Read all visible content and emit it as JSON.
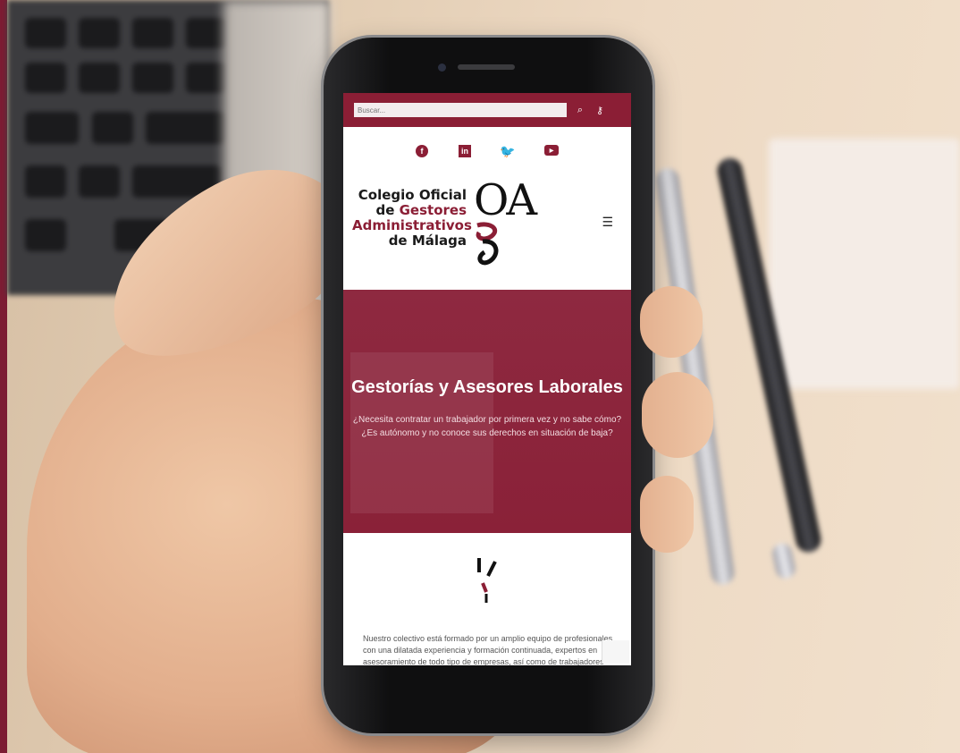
{
  "topbar": {
    "search_placeholder": "Buscar...",
    "search_icon": "search-icon",
    "key_icon": "key-icon"
  },
  "social": [
    {
      "name": "facebook-icon",
      "glyph": "f"
    },
    {
      "name": "linkedin-icon",
      "glyph": "in"
    },
    {
      "name": "twitter-icon",
      "glyph": "🐦"
    },
    {
      "name": "youtube-icon",
      "glyph": "▶"
    }
  ],
  "logo": {
    "line1": "Colegio Oficial",
    "line2_prefix": "de ",
    "line2_accent": "Gestores",
    "line3": "Administrativos",
    "line4": "de Málaga",
    "mark": "OA"
  },
  "hero": {
    "title": "Gestorías y Asesores Laborales",
    "subtitle_1": "¿Necesita contratar un trabajador por primera vez y no sabe cómo?",
    "subtitle_2": "¿Es autónomo y no conoce sus derechos en situación de baja?"
  },
  "content": {
    "body": "Nuestro colectivo está formado por un amplio equipo de profesionales con una dilatada experiencia y formación continuada, expertos en asesoramiento de todo tipo de empresas, así como de trabajadores"
  },
  "colors": {
    "brand": "#8b1e35",
    "skin": "#e2ae8c"
  }
}
